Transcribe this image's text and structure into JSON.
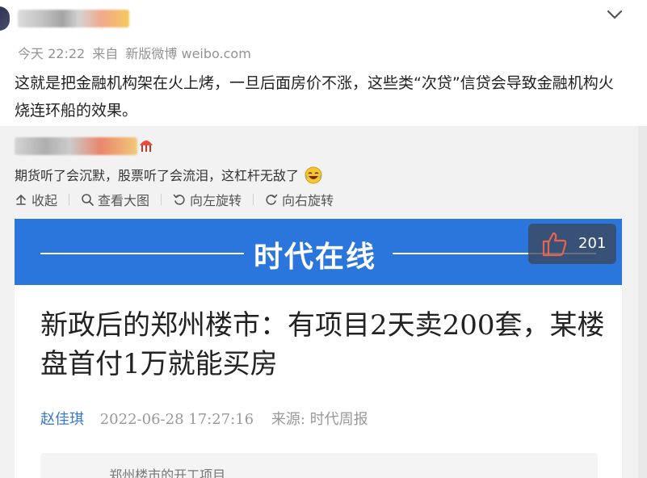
{
  "post": {
    "timestamp": "今天 22:22",
    "source_prefix": "来自",
    "source": "新版微博 weibo.com",
    "text": "这就是把金融机构架在火上烤，一旦后面房价不涨，这些类“次贷”信贷会导致金融机构火烧连环船的效果。"
  },
  "repost": {
    "comment": "期货听了会沉默，股票听了会流泪，这杠杆无敌了",
    "comment_emoji": "laughing-tears-icon",
    "toolbar": {
      "collapse": "收起",
      "view_large": "查看大图",
      "rotate_left": "向左旋转",
      "rotate_right": "向右旋转"
    }
  },
  "article": {
    "banner_title": "时代在线",
    "like_count": "201",
    "headline": "新政后的郑州楼市：有项目2天卖200套，某楼盘首付1万就能买房",
    "author": "赵佳琪",
    "datetime": "2022-06-28 17:27:16",
    "source_label": "来源: 时代周报",
    "quote_partial": "……  郑州楼市的开工项目……"
  },
  "colors": {
    "banner_blue": "#2b76dc",
    "author_blue": "#3a78c9",
    "repost_bg": "#f2f2f2",
    "like_thumb": "#e8644e"
  }
}
